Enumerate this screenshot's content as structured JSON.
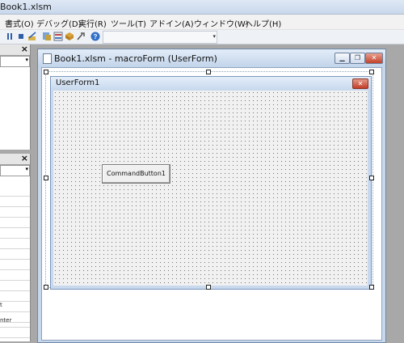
{
  "app": {
    "title": "Book1.xlsm"
  },
  "menu": {
    "items": [
      "書式(O)",
      "デバッグ(D)",
      "実行(R)",
      "ツール(T)",
      "アドイン(A)",
      "ウィンドウ(W)",
      "ヘルプ(H)"
    ]
  },
  "toolbar": {
    "icons": [
      "pause-icon",
      "stop-icon",
      "design-mode-icon",
      "project-explorer-icon",
      "properties-icon",
      "object-browser-icon",
      "toolbox-icon",
      "help-icon"
    ],
    "combo_value": ""
  },
  "project_pane": {
    "close_glyph": "×"
  },
  "props_pane": {
    "close_glyph": "×",
    "rows": [
      "t",
      "nter"
    ]
  },
  "child_window": {
    "title": "Book1.xlsm - macroForm (UserForm)"
  },
  "userform": {
    "caption": "UserForm1",
    "button_label": "CommandButton1"
  }
}
